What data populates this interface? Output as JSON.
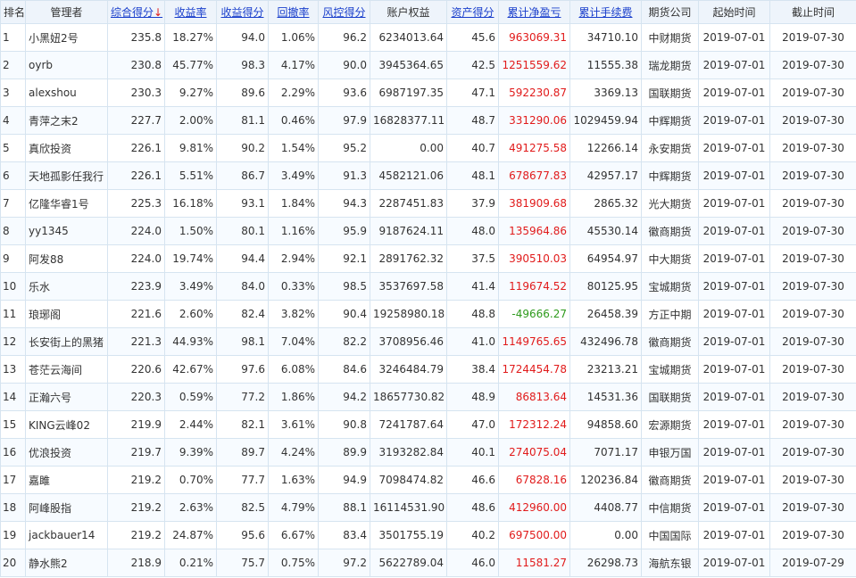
{
  "colors": {
    "positive": "#e11b1b",
    "negative": "#2e9a1c",
    "link": "#1a3fcc",
    "header_bg": "#eef4fb",
    "border": "#d6e4f0"
  },
  "headers": {
    "rank": "排名",
    "manager": "管理者",
    "score": "综合得分",
    "score_sort": "↓",
    "return_rate": "收益率",
    "return_score": "收益得分",
    "drawdown": "回撤率",
    "risk_score": "风控得分",
    "equity": "账户权益",
    "asset_score": "资产得分",
    "net_pnl": "累计净盈亏",
    "fees": "累计手续费",
    "company": "期货公司",
    "start": "起始时间",
    "end": "截止时间"
  },
  "rows": [
    {
      "rank": "1",
      "manager": "小黑妞2号",
      "score": "235.8",
      "return_rate": "18.27%",
      "return_score": "94.0",
      "drawdown": "1.06%",
      "risk_score": "96.2",
      "equity": "6234013.64",
      "asset_score": "45.6",
      "net_pnl": "963069.31",
      "fees": "34710.10",
      "company": "中财期货",
      "start": "2019-07-01",
      "end": "2019-07-30"
    },
    {
      "rank": "2",
      "manager": "oyrb",
      "score": "230.8",
      "return_rate": "45.77%",
      "return_score": "98.3",
      "drawdown": "4.17%",
      "risk_score": "90.0",
      "equity": "3945364.65",
      "asset_score": "42.5",
      "net_pnl": "1251559.62",
      "fees": "11555.38",
      "company": "瑞龙期货",
      "start": "2019-07-01",
      "end": "2019-07-30"
    },
    {
      "rank": "3",
      "manager": "alexshou",
      "score": "230.3",
      "return_rate": "9.27%",
      "return_score": "89.6",
      "drawdown": "2.29%",
      "risk_score": "93.6",
      "equity": "6987197.35",
      "asset_score": "47.1",
      "net_pnl": "592230.87",
      "fees": "3369.13",
      "company": "国联期货",
      "start": "2019-07-01",
      "end": "2019-07-30"
    },
    {
      "rank": "4",
      "manager": "青萍之末2",
      "score": "227.7",
      "return_rate": "2.00%",
      "return_score": "81.1",
      "drawdown": "0.46%",
      "risk_score": "97.9",
      "equity": "16828377.11",
      "asset_score": "48.7",
      "net_pnl": "331290.06",
      "fees": "1029459.94",
      "company": "中辉期货",
      "start": "2019-07-01",
      "end": "2019-07-30"
    },
    {
      "rank": "5",
      "manager": "真欣投资",
      "score": "226.1",
      "return_rate": "9.81%",
      "return_score": "90.2",
      "drawdown": "1.54%",
      "risk_score": "95.2",
      "equity": "0.00",
      "asset_score": "40.7",
      "net_pnl": "491275.58",
      "fees": "12266.14",
      "company": "永安期货",
      "start": "2019-07-01",
      "end": "2019-07-30"
    },
    {
      "rank": "6",
      "manager": "天地孤影任我行",
      "score": "226.1",
      "return_rate": "5.51%",
      "return_score": "86.7",
      "drawdown": "3.49%",
      "risk_score": "91.3",
      "equity": "4582121.06",
      "asset_score": "48.1",
      "net_pnl": "678677.83",
      "fees": "42957.17",
      "company": "中辉期货",
      "start": "2019-07-01",
      "end": "2019-07-30"
    },
    {
      "rank": "7",
      "manager": "亿隆华睿1号",
      "score": "225.3",
      "return_rate": "16.18%",
      "return_score": "93.1",
      "drawdown": "1.84%",
      "risk_score": "94.3",
      "equity": "2287451.83",
      "asset_score": "37.9",
      "net_pnl": "381909.68",
      "fees": "2865.32",
      "company": "光大期货",
      "start": "2019-07-01",
      "end": "2019-07-30"
    },
    {
      "rank": "8",
      "manager": "yy1345",
      "score": "224.0",
      "return_rate": "1.50%",
      "return_score": "80.1",
      "drawdown": "1.16%",
      "risk_score": "95.9",
      "equity": "9187624.11",
      "asset_score": "48.0",
      "net_pnl": "135964.86",
      "fees": "45530.14",
      "company": "徽商期货",
      "start": "2019-07-01",
      "end": "2019-07-30"
    },
    {
      "rank": "9",
      "manager": "阿发88",
      "score": "224.0",
      "return_rate": "19.74%",
      "return_score": "94.4",
      "drawdown": "2.94%",
      "risk_score": "92.1",
      "equity": "2891762.32",
      "asset_score": "37.5",
      "net_pnl": "390510.03",
      "fees": "64954.97",
      "company": "中大期货",
      "start": "2019-07-01",
      "end": "2019-07-30"
    },
    {
      "rank": "10",
      "manager": "乐水",
      "score": "223.9",
      "return_rate": "3.49%",
      "return_score": "84.0",
      "drawdown": "0.33%",
      "risk_score": "98.5",
      "equity": "3537697.58",
      "asset_score": "41.4",
      "net_pnl": "119674.52",
      "fees": "80125.95",
      "company": "宝城期货",
      "start": "2019-07-01",
      "end": "2019-07-30"
    },
    {
      "rank": "11",
      "manager": "琅琊阁",
      "score": "221.6",
      "return_rate": "2.60%",
      "return_score": "82.4",
      "drawdown": "3.82%",
      "risk_score": "90.4",
      "equity": "19258980.18",
      "asset_score": "48.8",
      "net_pnl": "-49666.27",
      "fees": "26458.39",
      "company": "方正中期",
      "start": "2019-07-01",
      "end": "2019-07-30"
    },
    {
      "rank": "12",
      "manager": "长安街上的黑猪",
      "score": "221.3",
      "return_rate": "44.93%",
      "return_score": "98.1",
      "drawdown": "7.04%",
      "risk_score": "82.2",
      "equity": "3708956.46",
      "asset_score": "41.0",
      "net_pnl": "1149765.65",
      "fees": "432496.78",
      "company": "徽商期货",
      "start": "2019-07-01",
      "end": "2019-07-30"
    },
    {
      "rank": "13",
      "manager": "苍茫云海间",
      "score": "220.6",
      "return_rate": "42.67%",
      "return_score": "97.6",
      "drawdown": "6.08%",
      "risk_score": "84.6",
      "equity": "3246484.79",
      "asset_score": "38.4",
      "net_pnl": "1724454.78",
      "fees": "23213.21",
      "company": "宝城期货",
      "start": "2019-07-01",
      "end": "2019-07-30"
    },
    {
      "rank": "14",
      "manager": "正瀚六号",
      "score": "220.3",
      "return_rate": "0.59%",
      "return_score": "77.2",
      "drawdown": "1.86%",
      "risk_score": "94.2",
      "equity": "18657730.82",
      "asset_score": "48.9",
      "net_pnl": "86813.64",
      "fees": "14531.36",
      "company": "国联期货",
      "start": "2019-07-01",
      "end": "2019-07-30"
    },
    {
      "rank": "15",
      "manager": "KING云峰02",
      "score": "219.9",
      "return_rate": "2.44%",
      "return_score": "82.1",
      "drawdown": "3.61%",
      "risk_score": "90.8",
      "equity": "7241787.64",
      "asset_score": "47.0",
      "net_pnl": "172312.24",
      "fees": "94858.60",
      "company": "宏源期货",
      "start": "2019-07-01",
      "end": "2019-07-30"
    },
    {
      "rank": "16",
      "manager": "优浪投资",
      "score": "219.7",
      "return_rate": "9.39%",
      "return_score": "89.7",
      "drawdown": "4.24%",
      "risk_score": "89.9",
      "equity": "3193282.84",
      "asset_score": "40.1",
      "net_pnl": "274075.04",
      "fees": "7071.17",
      "company": "申银万国",
      "start": "2019-07-01",
      "end": "2019-07-30"
    },
    {
      "rank": "17",
      "manager": "嘉雎",
      "score": "219.2",
      "return_rate": "0.70%",
      "return_score": "77.7",
      "drawdown": "1.63%",
      "risk_score": "94.9",
      "equity": "7098474.82",
      "asset_score": "46.6",
      "net_pnl": "67828.16",
      "fees": "120236.84",
      "company": "徽商期货",
      "start": "2019-07-01",
      "end": "2019-07-30"
    },
    {
      "rank": "18",
      "manager": "阿峰股指",
      "score": "219.2",
      "return_rate": "2.63%",
      "return_score": "82.5",
      "drawdown": "4.79%",
      "risk_score": "88.1",
      "equity": "16114531.90",
      "asset_score": "48.6",
      "net_pnl": "412960.00",
      "fees": "4408.77",
      "company": "中信期货",
      "start": "2019-07-01",
      "end": "2019-07-30"
    },
    {
      "rank": "19",
      "manager": "jackbauer14",
      "score": "219.2",
      "return_rate": "24.87%",
      "return_score": "95.6",
      "drawdown": "6.67%",
      "risk_score": "83.4",
      "equity": "3501755.19",
      "asset_score": "40.2",
      "net_pnl": "697500.00",
      "fees": "0.00",
      "company": "中国国际",
      "start": "2019-07-01",
      "end": "2019-07-30"
    },
    {
      "rank": "20",
      "manager": "静水熊2",
      "score": "218.9",
      "return_rate": "0.21%",
      "return_score": "75.7",
      "drawdown": "0.75%",
      "risk_score": "97.2",
      "equity": "5622789.04",
      "asset_score": "46.0",
      "net_pnl": "11581.27",
      "fees": "26298.73",
      "company": "海航东银",
      "start": "2019-07-01",
      "end": "2019-07-29"
    }
  ]
}
